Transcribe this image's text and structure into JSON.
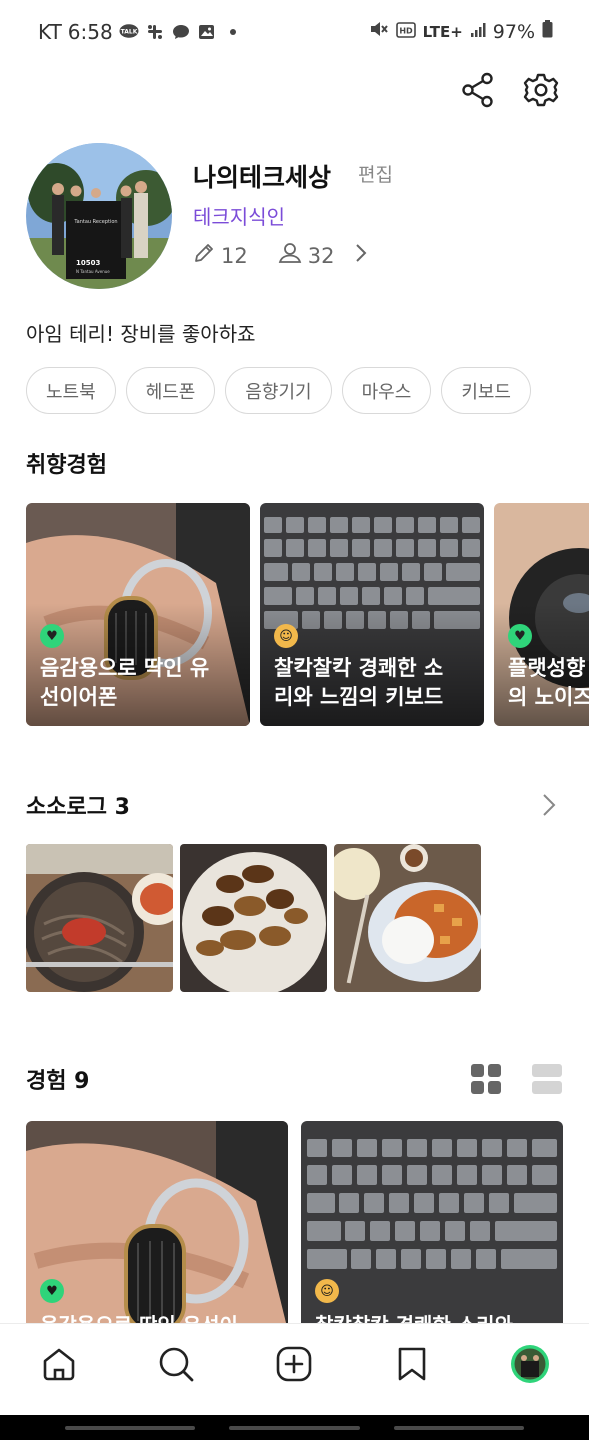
{
  "status_bar": {
    "carrier": "KT",
    "time": "6:58",
    "icons": [
      "kakaotalk-icon",
      "slack-icon",
      "chat-icon",
      "image-icon",
      "dot-icon"
    ],
    "talk_label": "TALK",
    "network": "LTE+",
    "battery": "97%"
  },
  "profile": {
    "name": "나의테크세상",
    "edit_label": "편집",
    "level": "테크지식인",
    "posts_count": "12",
    "followers_count": "32",
    "bio": "아임 테리! 장비를 좋아하죠",
    "avatar_sign": {
      "line1": "Tantau Reception",
      "line2": "10503",
      "line3": "N Tantau Avenue"
    }
  },
  "tags": [
    "노트북",
    "헤드폰",
    "음향기기",
    "마우스",
    "키보드"
  ],
  "taste": {
    "title": "취향경험",
    "cards": [
      {
        "caption": "음감용으로 딱인 유\n선이어폰",
        "emoji": "love"
      },
      {
        "caption": "찰칵찰칵 경쾌한 소\n리와 느낌의 키보드",
        "emoji": "smile"
      },
      {
        "caption": "플랫성향\n의 노이즈",
        "emoji": "love"
      }
    ]
  },
  "sosolog": {
    "title": "소소로그 3",
    "images": [
      "noodle-photo",
      "chicken-photo",
      "mapo-tofu-photo"
    ]
  },
  "experiences": {
    "title": "경험 9",
    "cards": [
      {
        "caption": "음감용으로 딱인 유선이",
        "emoji": "love"
      },
      {
        "caption": "찰칵찰칵 경쾌한 소리와",
        "emoji": "smile"
      }
    ]
  },
  "colors": {
    "accent": "#7b4cd8",
    "love_emoji": "#2fd47a",
    "smile_emoji": "#f2b84b"
  }
}
